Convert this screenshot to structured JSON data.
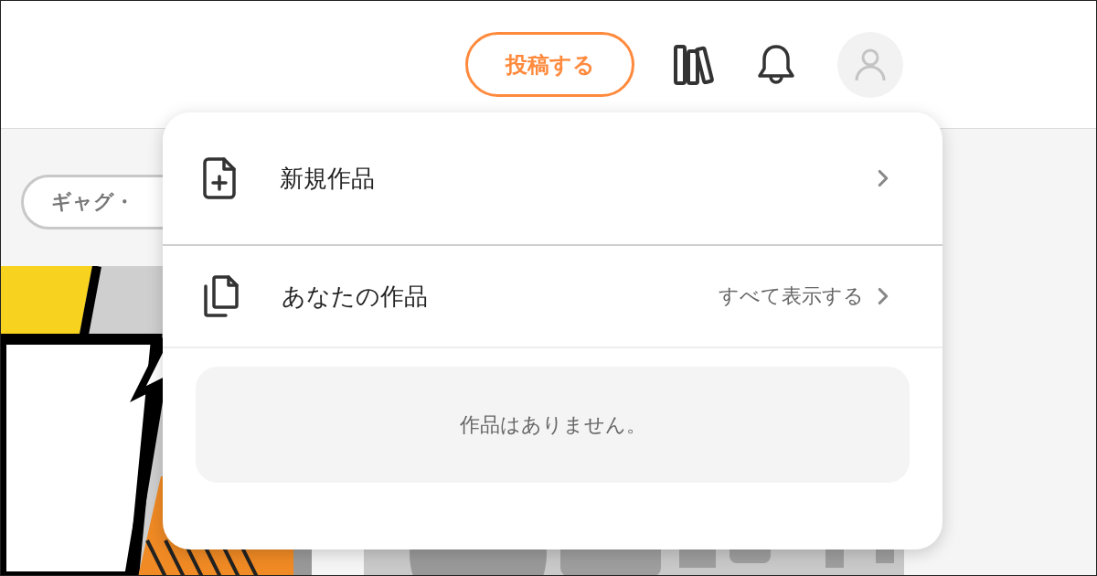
{
  "header": {
    "post_button": "投稿する"
  },
  "genre_chips": [
    {
      "label": "ギャグ・"
    }
  ],
  "menu": {
    "items": [
      {
        "kind": "new",
        "label": "新規作品"
      },
      {
        "kind": "list",
        "label": "あなたの作品",
        "link": "すべて表示する"
      }
    ],
    "empty_message": "作品はありません。"
  }
}
